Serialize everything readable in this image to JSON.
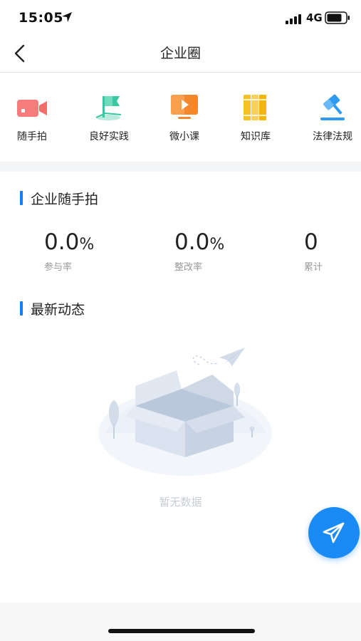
{
  "status_bar": {
    "time": "15:05",
    "network": "4G",
    "icons": [
      "location-arrow-icon",
      "signal-bars-icon",
      "battery-icon"
    ]
  },
  "header": {
    "title": "企业圈",
    "back_icon": "chevron-left-icon"
  },
  "shortcuts": [
    {
      "label": "随手拍",
      "icon": "video-camera-icon",
      "color": "#f06f6f"
    },
    {
      "label": "良好实践",
      "icon": "flag-icon",
      "color": "#38c7a0"
    },
    {
      "label": "微小课",
      "icon": "play-screen-icon",
      "color": "#f5882c"
    },
    {
      "label": "知识库",
      "icon": "books-icon",
      "color": "#f7c126"
    },
    {
      "label": "法律法规",
      "icon": "gavel-icon",
      "color": "#2f9bf0"
    }
  ],
  "section_snapshot": {
    "title": "企业随手拍"
  },
  "stats": [
    {
      "number": "0.0",
      "unit": "%",
      "caption": "参与率"
    },
    {
      "number": "0.0",
      "unit": "%",
      "caption": "整改率"
    },
    {
      "number": "0",
      "unit": "",
      "caption": "累计"
    }
  ],
  "section_news": {
    "title": "最新动态"
  },
  "empty_state": {
    "text": "暂无数据",
    "icon": "empty-box-icon"
  },
  "fab": {
    "icon": "paper-plane-icon",
    "color": "#1a8af5"
  },
  "colors": {
    "accent": "#1a7cf0",
    "caption": "#999999",
    "empty_text": "#c8cdd4"
  }
}
